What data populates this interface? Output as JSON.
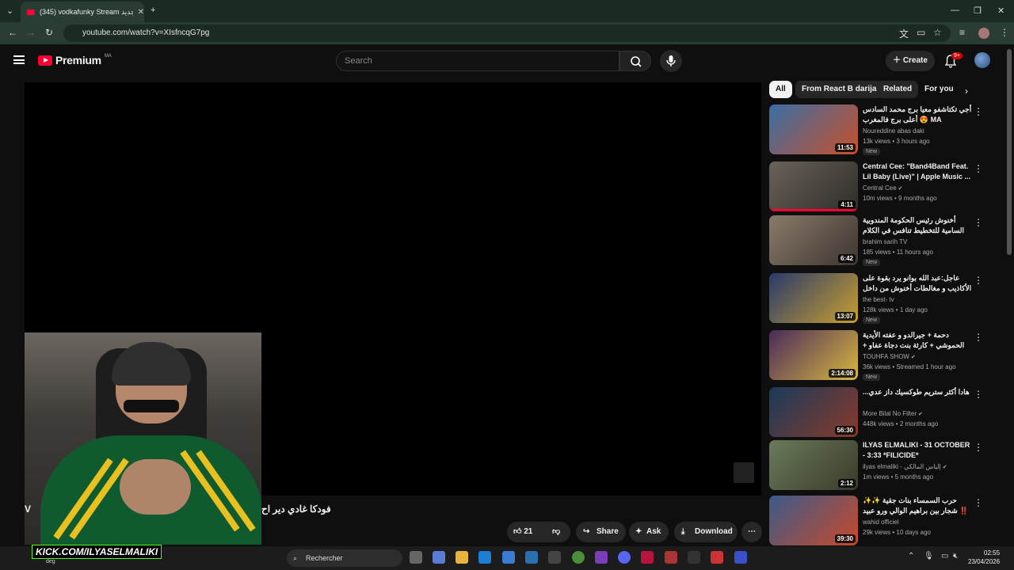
{
  "browser": {
    "tab_title": "(345) vodkafunky Stream جديد",
    "url": "youtube.com/watch?v=XIsfncqG7pg"
  },
  "header": {
    "brand": "Premium",
    "region": "MA",
    "search_placeholder": "Search",
    "create_label": "Create",
    "notif_count": "9+"
  },
  "player": {
    "title": "فودكا غادي دير اح",
    "title_prefix": "V",
    "likes": "21",
    "share_label": "Share",
    "ask_label": "Ask",
    "download_label": "Download"
  },
  "chips": [
    "All",
    "From React B darija",
    "Related",
    "For you"
  ],
  "related": [
    {
      "title": "أجي تكتاشفو معيا برج محمد السادس 😍 أعلى برج فالمغرب MA",
      "channel": "Noureddine abas daki",
      "meta": "13k views • 3 hours ago",
      "new": "New",
      "duration": "11:53",
      "verified": false,
      "progress": 0
    },
    {
      "title": "Central Cee: \"Band4Band Feat. Lil Baby (Live)\" | Apple Music ...",
      "channel": "Central Cee",
      "meta": "10m views • 9 months ago",
      "new": "",
      "duration": "4:11",
      "verified": true,
      "progress": 1
    },
    {
      "title": "أخنوش رئيس الحكومة المندوبية السامية للتخطيط تنافس في الكلام",
      "channel": "brahim sarih TV",
      "meta": "185 views • 11 hours ago",
      "new": "New",
      "duration": "6:42",
      "verified": false,
      "progress": 0
    },
    {
      "title": "عاجل:عبد الله بوانو يرد بقوة على الأكاذيب و مغالطات أخنوش من داخل البرلمان",
      "channel": "the best- tv",
      "meta": "128k views • 1 day ago",
      "new": "New",
      "duration": "13:07",
      "verified": false,
      "progress": 0
    },
    {
      "title": "دحمة + جيرالدو و عفته الأيدية الحموشي + كارثة بنت دجاة عفاو + ضربيات مولاهم ...",
      "channel": "TOUHFA SHOW",
      "meta": "36k views • Streamed 1 hour ago",
      "new": "New",
      "duration": "2:14:08",
      "verified": true,
      "progress": 0
    },
    {
      "title": "...هادا أكثر ستريم طوكسيك داز عدي",
      "channel": "More Bilal No Filter",
      "meta": "448k views • 2 months ago",
      "new": "",
      "duration": "56:30",
      "verified": true,
      "progress": 0
    },
    {
      "title": "ILYAS ELMALIKI - 31 OCTOBER - 3:33 *FILICIDE*",
      "channel": "ilyas elmaliki - إلياس المالكي",
      "meta": "1m views • 5 months ago",
      "new": "",
      "duration": "2:12",
      "verified": true,
      "progress": 0
    },
    {
      "title": "✨حرب السمساء بنات جقية ✨ شجار بين براهيم الوالي ورو عبيد ‼️",
      "channel": "wahid officiel",
      "meta": "29k views • 10 days ago",
      "new": "",
      "duration": "39:30",
      "verified": false,
      "progress": 0
    }
  ],
  "overlay": {
    "kick": "KICK.COM/ILYASELMALIKI",
    "deg": "deg"
  },
  "taskbar": {
    "search_placeholder": "Rechercher",
    "time": "02:55",
    "date": "23/04/2026"
  },
  "colors": {
    "youtube_red": "#ff0033",
    "kick_green": "#53fc18",
    "jacket_green": "#0f5a2e"
  }
}
